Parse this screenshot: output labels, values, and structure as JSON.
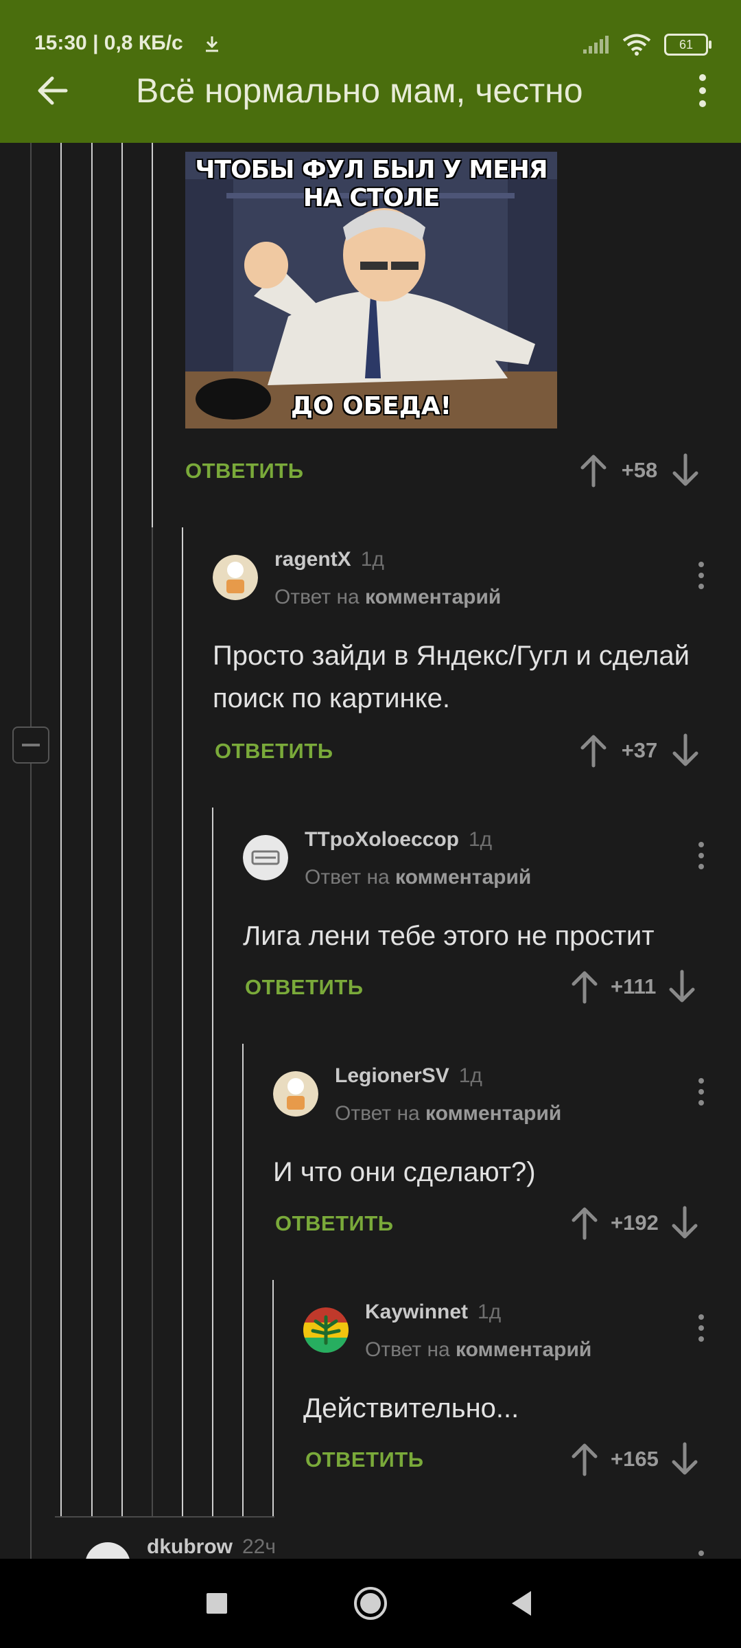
{
  "status_bar": {
    "time": "15:30 | 0,8 КБ/с",
    "battery": "61"
  },
  "app_bar": {
    "title": "Всё нормально мам, честно"
  },
  "meme": {
    "top_text": "ЧТОБЫ ФУЛ БЫЛ У МЕНЯ НА СТОЛЕ",
    "bottom_text": "ДО ОБЕДА!"
  },
  "top_comment": {
    "reply_label": "ОТВЕТИТЬ",
    "score": "+58"
  },
  "comments": [
    {
      "author": "ragentX",
      "age": "1д",
      "reply_to_prefix": "Ответ на",
      "reply_to_link": "комментарий",
      "text": "Просто зайди в Яндекс/Гугл и сделай поиск по картинке.",
      "reply_label": "ОТВЕТИТЬ",
      "score": "+37"
    },
    {
      "author": "TTpoXoloeccop",
      "age": "1д",
      "reply_to_prefix": "Ответ на",
      "reply_to_link": "комментарий",
      "text": "Лига лени тебе этого не простит",
      "reply_label": "ОТВЕТИТЬ",
      "score": "+111"
    },
    {
      "author": "LegionerSV",
      "age": "1д",
      "reply_to_prefix": "Ответ на",
      "reply_to_link": "комментарий",
      "text": "И что они сделают?)",
      "reply_label": "ОТВЕТИТЬ",
      "score": "+192"
    },
    {
      "author": "Kaywinnet",
      "age": "1д",
      "reply_to_prefix": "Ответ на",
      "reply_to_link": "комментарий",
      "text": "Действительно...",
      "reply_label": "ОТВЕТИТЬ",
      "score": "+165"
    }
  ],
  "next_comment": {
    "author": "dkubrow",
    "age": "22ч"
  },
  "colors": {
    "app_bar": "#4a6e0d",
    "background": "#1b1b1b",
    "reply_accent": "#7aaa3a",
    "nav_bar": "#000000"
  },
  "icons": [
    "arrow-back-icon",
    "more-vert-icon",
    "arrow-up-icon",
    "arrow-down-icon",
    "collapse-icon",
    "nav-recents-icon",
    "nav-home-icon",
    "nav-back-icon"
  ]
}
